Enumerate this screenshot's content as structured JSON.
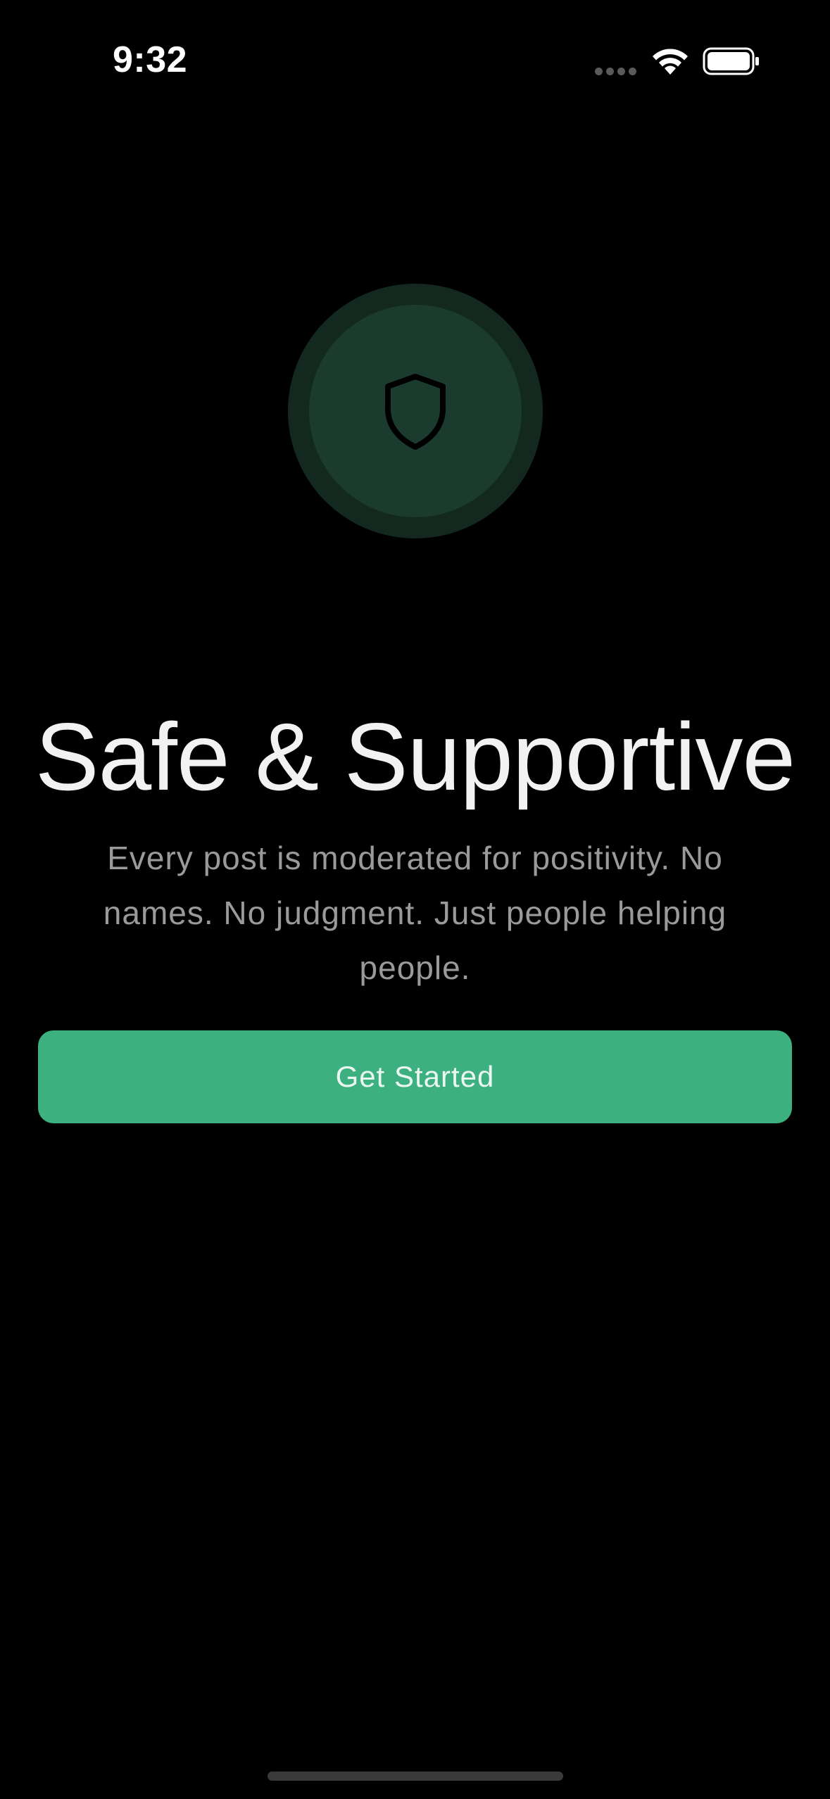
{
  "status_bar": {
    "time": "9:32"
  },
  "hero": {
    "icon": "shield-icon",
    "ring_color": "#13281f",
    "circle_color": "#1a3b2d"
  },
  "onboarding": {
    "title": "Safe & Supportive",
    "subtitle": "Every post is moderated for positivity. No names. No judgment. Just people helping people."
  },
  "actions": {
    "primary_label": "Get Started",
    "primary_color": "#3cb07e"
  }
}
